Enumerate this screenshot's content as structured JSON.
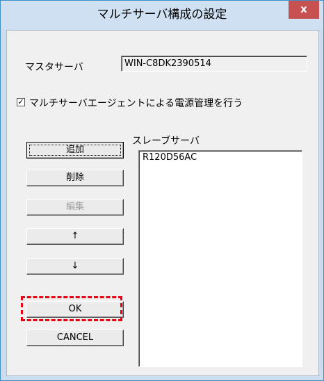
{
  "window": {
    "title": "マルチサーバ構成の設定",
    "close_label": "x"
  },
  "master": {
    "label": "マスタサーバ",
    "value": "WIN-C8DK2390514"
  },
  "power_mgmt": {
    "checked": true,
    "check_mark": "✓",
    "label": "マルチサーバエージェントによる電源管理を行う"
  },
  "slave": {
    "label": "スレーブサーバ",
    "items": [
      "R120D56AC"
    ]
  },
  "buttons": {
    "add": "追加",
    "delete": "削除",
    "edit": "編集",
    "up": "↑",
    "down": "↓",
    "ok": "OK",
    "cancel": "CANCEL"
  },
  "colors": {
    "highlight": "#e60012",
    "close_button": "#c75050"
  }
}
